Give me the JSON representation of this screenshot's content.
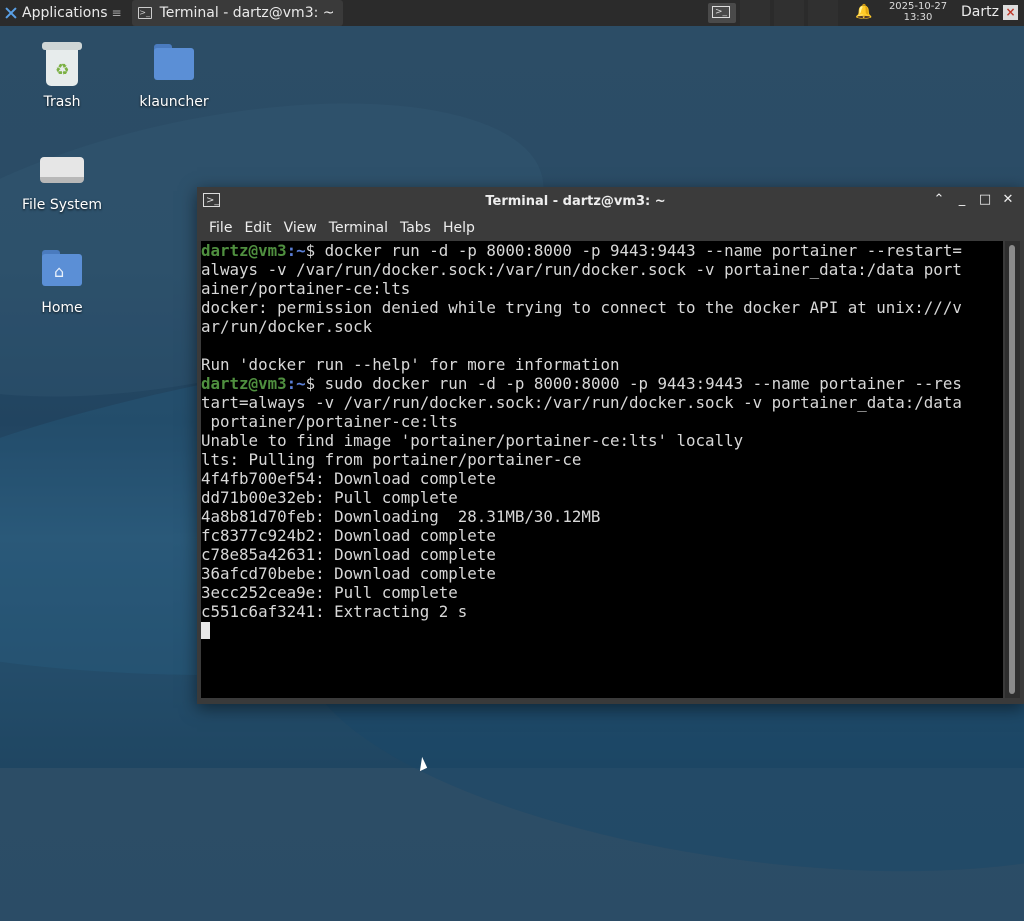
{
  "panel": {
    "applications_label": "Applications",
    "applications_icon": "xfce-logo-icon",
    "task_label": "Terminal - dartz@vm3: ~",
    "clock_date": "2025-10-27",
    "clock_time": "13:30",
    "user": "Dartz"
  },
  "desktop": {
    "icons": [
      {
        "label": "Trash",
        "icon": "trash-icon"
      },
      {
        "label": "klauncher",
        "icon": "folder-icon"
      },
      {
        "label": "File System",
        "icon": "drive-icon"
      },
      {
        "label": "Home",
        "icon": "home-folder-icon"
      }
    ]
  },
  "terminal": {
    "title": "Terminal - dartz@vm3: ~",
    "menu": [
      "File",
      "Edit",
      "View",
      "Terminal",
      "Tabs",
      "Help"
    ],
    "prompt_user": "dartz@vm3",
    "prompt_path": ":~",
    "prompt_symbol": "$ ",
    "cmd1_lines": [
      "docker run -d -p 8000:8000 -p 9443:9443 --name portainer --restart=",
      "always -v /var/run/docker.sock:/var/run/docker.sock -v portainer_data:/data port",
      "ainer/portainer-ce:lts"
    ],
    "out1": [
      "docker: permission denied while trying to connect to the docker API at unix:///v",
      "ar/run/docker.sock",
      "",
      "Run 'docker run --help' for more information"
    ],
    "cmd2_lines": [
      "sudo docker run -d -p 8000:8000 -p 9443:9443 --name portainer --res",
      "tart=always -v /var/run/docker.sock:/var/run/docker.sock -v portainer_data:/data",
      " portainer/portainer-ce:lts"
    ],
    "out2": [
      "Unable to find image 'portainer/portainer-ce:lts' locally",
      "lts: Pulling from portainer/portainer-ce",
      "4f4fb700ef54: Download complete",
      "dd71b00e32eb: Pull complete",
      "4a8b81d70feb: Downloading  28.31MB/30.12MB",
      "fc8377c924b2: Download complete",
      "c78e85a42631: Download complete",
      "36afcd70bebe: Download complete",
      "3ecc252cea9e: Pull complete",
      "c551c6af3241: Extracting 2 s"
    ]
  }
}
